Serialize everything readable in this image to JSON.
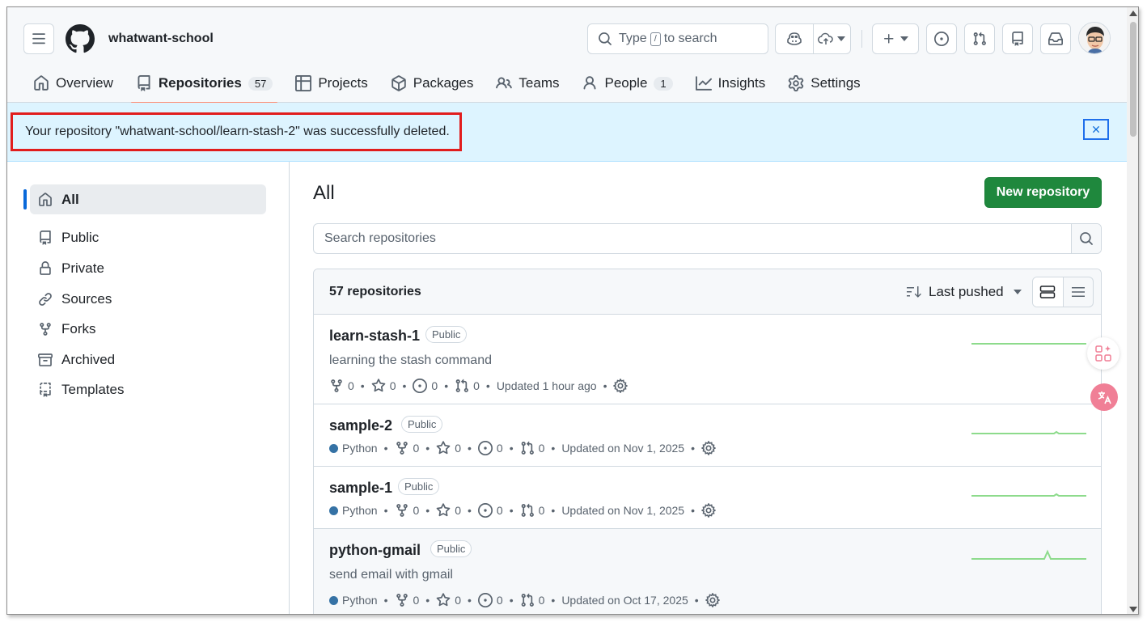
{
  "header": {
    "org_name": "whatwant-school",
    "search": {
      "type_label": "Type",
      "kbd": "/",
      "to_search_label": "to search"
    }
  },
  "tabs": [
    {
      "label": "Overview",
      "icon": "home-icon"
    },
    {
      "label": "Repositories",
      "icon": "repo-icon",
      "counter": "57",
      "active": true
    },
    {
      "label": "Projects",
      "icon": "table-icon"
    },
    {
      "label": "Packages",
      "icon": "package-icon"
    },
    {
      "label": "Teams",
      "icon": "people-icon"
    },
    {
      "label": "People",
      "icon": "person-icon",
      "counter": "1"
    },
    {
      "label": "Insights",
      "icon": "graph-icon"
    },
    {
      "label": "Settings",
      "icon": "gear-icon"
    }
  ],
  "flash": {
    "message": "Your repository \"whatwant-school/learn-stash-2\" was successfully deleted."
  },
  "sidebar": {
    "items": [
      {
        "label": "All",
        "icon": "home-icon",
        "active": true
      },
      {
        "label": "Public",
        "icon": "repo-icon"
      },
      {
        "label": "Private",
        "icon": "repo-locked-icon"
      },
      {
        "label": "Sources",
        "icon": "link-icon"
      },
      {
        "label": "Forks",
        "icon": "fork-icon"
      },
      {
        "label": "Archived",
        "icon": "archive-icon"
      },
      {
        "label": "Templates",
        "icon": "repo-template-icon"
      }
    ]
  },
  "main": {
    "title": "All",
    "new_repo_label": "New repository",
    "search_placeholder": "Search repositories",
    "list_count": "57 repositories",
    "sort_label": "Last pushed"
  },
  "repos": [
    {
      "name": "learn-stash-1",
      "visibility": "Public",
      "description": "learning the stash command",
      "language": "",
      "forks": "0",
      "stars": "0",
      "issues": "0",
      "prs": "0",
      "updated": "Updated 1 hour ago"
    },
    {
      "name": "sample-2",
      "visibility": "Public",
      "description": "",
      "language": "Python",
      "forks": "0",
      "stars": "0",
      "issues": "0",
      "prs": "0",
      "updated": "Updated on Nov 1, 2025"
    },
    {
      "name": "sample-1",
      "visibility": "Public",
      "description": "",
      "language": "Python",
      "forks": "0",
      "stars": "0",
      "issues": "0",
      "prs": "0",
      "updated": "Updated on Nov 1, 2025"
    },
    {
      "name": "python-gmail",
      "visibility": "Public",
      "description": "send email with gmail",
      "language": "Python",
      "forks": "0",
      "stars": "0",
      "issues": "0",
      "prs": "0",
      "updated": "Updated on Oct 17, 2025"
    }
  ],
  "colors": {
    "accent": "#0969da",
    "success": "#1f883d",
    "tab_underline": "#fd8c73",
    "python": "#3572A5",
    "flash_bg": "#ddf4ff",
    "highlight": "#e11d1d"
  }
}
